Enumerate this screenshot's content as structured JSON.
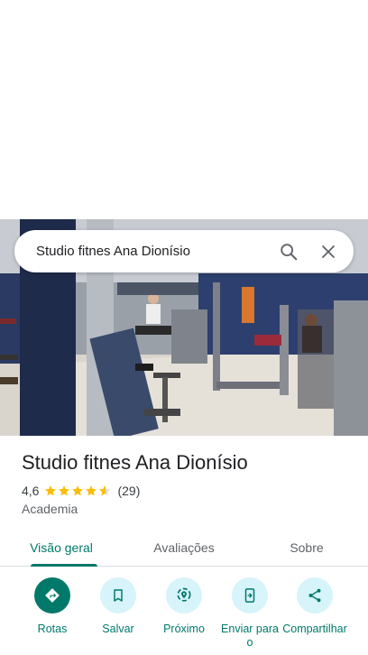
{
  "search": {
    "query": "Studio fitnes Ana Dionísio"
  },
  "place": {
    "name": "Studio fitnes Ana Dionísio",
    "rating": "4,6",
    "stars": 4.6,
    "review_count": "(29)",
    "category": "Academia"
  },
  "tabs": [
    {
      "label": "Visão geral",
      "active": true
    },
    {
      "label": "Avaliações",
      "active": false
    },
    {
      "label": "Sobre",
      "active": false
    }
  ],
  "actions": [
    {
      "label": "Rotas",
      "icon": "directions-icon"
    },
    {
      "label": "Salvar",
      "icon": "bookmark-icon"
    },
    {
      "label": "Próximo",
      "icon": "nearby-icon"
    },
    {
      "label": "Enviar para o",
      "icon": "send-to-phone-icon"
    },
    {
      "label": "Compartilhar",
      "icon": "share-icon"
    }
  ],
  "colors": {
    "accent": "#00796b",
    "star": "#fbbc04",
    "chip_bg": "#d6f4fa"
  }
}
